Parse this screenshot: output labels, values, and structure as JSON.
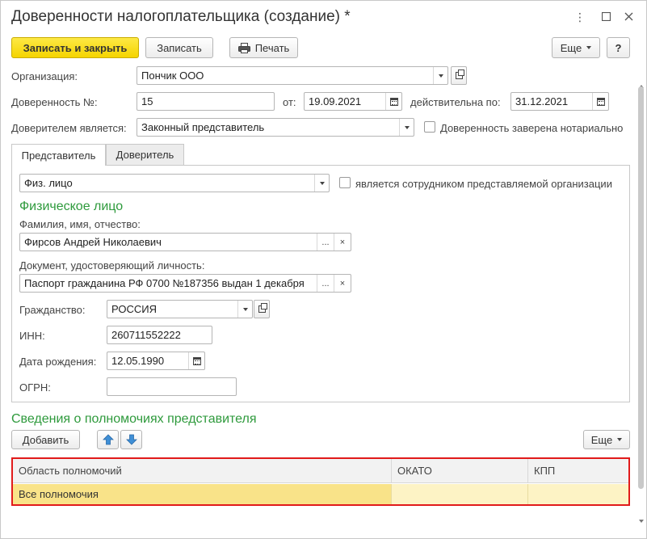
{
  "window": {
    "title": "Доверенности налогоплательщика (создание) *",
    "menu_icon": "kebab-menu-icon",
    "maximize_icon": "maximize-icon",
    "close_icon": "close-icon"
  },
  "toolbar": {
    "save_close": "Записать и закрыть",
    "save": "Записать",
    "print": "Печать",
    "more": "Еще",
    "help": "?"
  },
  "header": {
    "org_label": "Организация:",
    "org_value": "Пончик ООО",
    "poa_label": "Доверенность №:",
    "poa_number": "15",
    "from_label": "от:",
    "from_date": "19.09.2021",
    "valid_label": "действительна по:",
    "valid_date": "31.12.2021",
    "principal_label": "Доверителем является:",
    "principal_value": "Законный представитель",
    "notarized_label": "Доверенность заверена нотариально",
    "notarized_checked": false
  },
  "tabs": [
    {
      "label": "Представитель",
      "active": true
    },
    {
      "label": "Доверитель",
      "active": false
    }
  ],
  "representative": {
    "type_value": "Физ. лицо",
    "employee_label": "является сотрудником представляемой организации",
    "employee_checked": false,
    "section_title": "Физическое лицо",
    "fio_label": "Фамилия, имя, отчество:",
    "fio_value": "Фирсов Андрей Николаевич",
    "doc_label": "Документ, удостоверяющий личность:",
    "doc_value": "Паспорт гражданина РФ 0700 №187356 выдан 1 декабря",
    "select_btn": "...",
    "clear_btn": "×",
    "citizenship_label": "Гражданство:",
    "citizenship_value": "РОССИЯ",
    "inn_label": "ИНН:",
    "inn_value": "260711552222",
    "birth_label": "Дата рождения:",
    "birth_value": "12.05.1990",
    "ogrn_label": "ОГРН:",
    "ogrn_value": ""
  },
  "powers": {
    "section_title": "Сведения о полномочиях представителя",
    "add_button": "Добавить",
    "up_icon": "arrow-up-icon",
    "down_icon": "arrow-down-icon",
    "more": "Еще",
    "columns": [
      "Область полномочий",
      "ОКАТО",
      "КПП"
    ],
    "rows": [
      {
        "scope": "Все полномочия",
        "okato": "",
        "kpp": ""
      }
    ]
  }
}
